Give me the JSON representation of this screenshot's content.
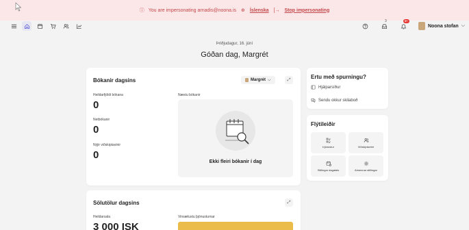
{
  "banner": {
    "message": "You are impersonating arnadis@noona.is",
    "language": "Íslenska",
    "stop": "Stop impersonating"
  },
  "nav": {
    "notifications_count": "3",
    "badge": "9+",
    "user_name": "Noona stofan"
  },
  "greeting": {
    "date": "Þriðjudagur, 16. júní",
    "title": "Góðan dag, Margrét"
  },
  "bookings": {
    "title": "Bókanir dagsins",
    "staff": "Margrét",
    "total_label": "Heildarfjöldi bókana",
    "total_value": "0",
    "online_label": "Netbókanir",
    "online_value": "0",
    "new_label": "Nýjir viðskiptavinir",
    "new_value": "0",
    "upcoming_label": "Næstu bókanir",
    "empty_text": "Ekki fleiri bókanir í dag"
  },
  "questions": {
    "title": "Ertu með spurningu?",
    "help": "Hjálparsíður",
    "message": "Sendu okkur skilaboð"
  },
  "shortcuts": {
    "title": "Flýtileiðir",
    "items": [
      {
        "label": "Þjónustur"
      },
      {
        "label": "Viðskiptavinir"
      },
      {
        "label": "Stillingar dagatals"
      },
      {
        "label": "Almennar stillingar"
      }
    ]
  },
  "sales": {
    "title": "Sölutölur dagsins",
    "total_label": "Heildarsala",
    "total_value": "3 000 ISK",
    "popular_label": "Vinsælustu þjónusturnar"
  },
  "colors": {
    "banner_bg": "#fbe7e7",
    "banner_text": "#c2464a",
    "accent": "#5b5bd6",
    "popular_bar": "#ecbc4a"
  }
}
